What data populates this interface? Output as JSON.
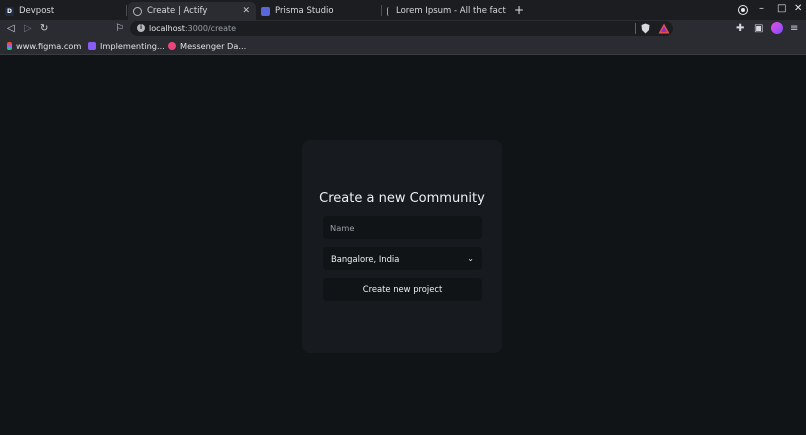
{
  "tabs": [
    {
      "title": "Devpost",
      "favicon": "devpost-icon",
      "active": false
    },
    {
      "title": "Create | Actify",
      "favicon": "globe-icon",
      "active": true
    },
    {
      "title": "Prisma Studio",
      "favicon": "prisma-icon",
      "active": false
    },
    {
      "title": "Lorem Ipsum - All the facts - Li",
      "favicon": "lorem-icon",
      "active": false
    }
  ],
  "address_bar": {
    "host": "localhost",
    "path": ":3000/create"
  },
  "bookmarks": [
    {
      "label": "www.figma.com",
      "icon": "figma-icon"
    },
    {
      "label": "Implementing...",
      "icon": "bookmark-purple-icon"
    },
    {
      "label": "Messenger Da...",
      "icon": "messenger-icon"
    }
  ],
  "form": {
    "title": "Create a new Community",
    "name_placeholder": "Name",
    "name_value": "",
    "location_selected": "Bangalore, India",
    "submit_label": "Create new project"
  },
  "colors": {
    "page_background": "#111417",
    "card_background": "#171b1f",
    "browser_chrome": "#2a2c31",
    "tab_strip": "#1c1d21"
  }
}
